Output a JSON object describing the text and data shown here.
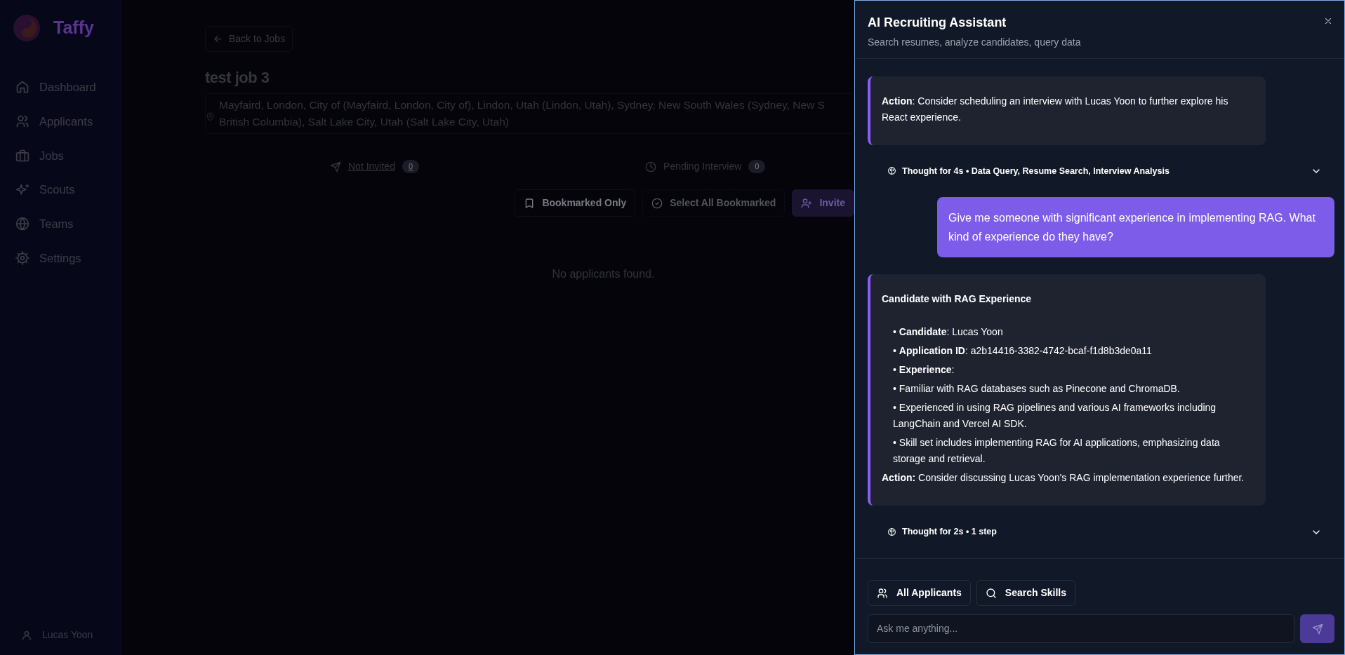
{
  "sidebar": {
    "brand": "Taffy",
    "items": [
      {
        "label": "Dashboard"
      },
      {
        "label": "Applicants"
      },
      {
        "label": "Jobs"
      },
      {
        "label": "Scouts"
      },
      {
        "label": "Teams"
      },
      {
        "label": "Settings"
      }
    ],
    "user": "Lucas Yoon"
  },
  "job": {
    "back_button": "Back to Jobs",
    "title": "test job 3",
    "location_lines": [
      "Mayfaird, London, City of (Mayfaird, London, City of), Lindon, Utah (Lindon, Utah), Sydney, New South Wales (Sydney, New S",
      "British Columbia), Salt Lake City, Utah (Salt Lake City, Utah)"
    ],
    "stats": [
      {
        "label": "Not Invited",
        "count": "0",
        "selected": true
      },
      {
        "label": "Pending Interview",
        "count": "0",
        "selected": false
      }
    ],
    "actions": [
      {
        "label": "Bookmarked Only",
        "kind": "outline",
        "disabled": false
      },
      {
        "label": "Select All Bookmarked",
        "kind": "outline",
        "disabled": true
      },
      {
        "label": "Invite",
        "kind": "primary",
        "disabled": false
      }
    ],
    "empty_message": "No applicants found."
  },
  "assistant": {
    "title": "AI Recruiting Assistant",
    "subtitle": "Search resumes, analyze candidates, query data",
    "messages": [
      {
        "kind": "assistant",
        "paragraphs": [
          "**Action**: Consider scheduling an interview with Lucas Yoon to further explore his React experience."
        ]
      },
      {
        "kind": "thought",
        "text": "Thought for 4s • Data Query, Resume Search, Interview Analysis",
        "expanded": false
      },
      {
        "kind": "user",
        "text": "Give me someone with significant experience in implementing RAG. What kind of experience do they have?"
      },
      {
        "kind": "assistant",
        "heading": "Candidate with RAG Experience",
        "bullets": [
          "• **Candidate**: Lucas Yoon",
          "• **Application ID**: a2b14416-3382-4742-bcaf-f1d8b3de0a11",
          "• **Experience**:",
          "• Familiar with RAG databases such as Pinecone and ChromaDB.",
          "• Experienced in using RAG pipelines and various AI frameworks including LangChain and Vercel AI SDK.",
          "• Skill set includes implementing RAG for AI applications, emphasizing data storage and retrieval."
        ],
        "paragraphs": [
          "**Action:** Consider discussing Lucas Yoon's RAG implementation experience further."
        ]
      },
      {
        "kind": "thought",
        "text": "Thought for 2s • 1 step",
        "expanded": false
      }
    ],
    "quick_actions": [
      {
        "label": "All Applicants"
      },
      {
        "label": "Search Skills"
      }
    ],
    "input": {
      "placeholder": "Ask me anything..."
    },
    "send_button": {
      "disabled": true
    }
  }
}
